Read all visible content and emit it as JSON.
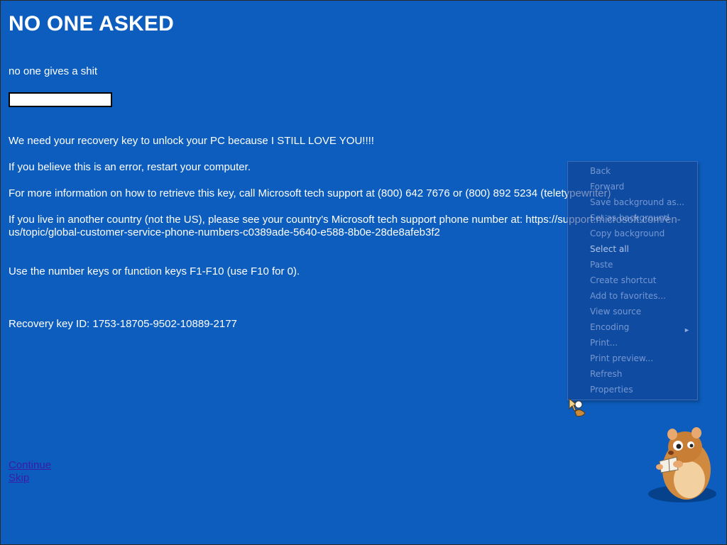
{
  "page": {
    "title": "NO ONE ASKED",
    "subtitle": "no one gives a shit",
    "key_input_value": "",
    "paragraphs": [
      "We need your recovery key to unlock your PC because I STILL LOVE YOU!!!!",
      "If you believe this is an error, restart your computer.",
      "For more information on how to retrieve this key, call Microsoft tech support at (800) 642 7676 or (800) 892 5234 (teletypewriter)",
      "If you live in another country (not the US), please see your country's Microsoft tech support phone number at: https://support.microsoft.com/en-us/topic/global-customer-service-phone-numbers-c0389ade-5640-e588-8b0e-28de8afeb3f2",
      "Use the number keys or function keys F1-F10 (use F10 for 0).",
      "Recovery key ID: 1753-18705-9502-10889-2177"
    ],
    "links": {
      "continue": "Continue",
      "skip": "Skip"
    }
  },
  "context_menu": {
    "items": [
      "Back",
      "Forward",
      "Save background as...",
      "Set as background",
      "Copy background",
      "Select all",
      "Paste",
      "Create shortcut",
      "Add to favorites...",
      "View source",
      "Encoding",
      "Print...",
      "Print preview...",
      "Refresh",
      "Properties"
    ],
    "submenu_arrow_icon": "chevron-right-icon"
  },
  "colors": {
    "background": "#0c5dbd",
    "text": "#ffffff",
    "link": "#3b1ca8"
  }
}
